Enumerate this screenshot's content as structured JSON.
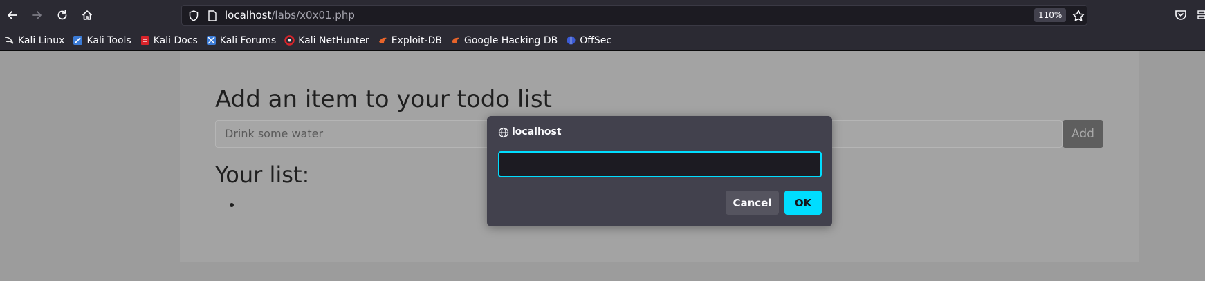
{
  "browser": {
    "url_host": "localhost",
    "url_path": "/labs/x0x01.php",
    "zoom": "110%",
    "icons": {
      "back": "back-arrow-icon",
      "forward": "forward-arrow-icon",
      "reload": "reload-icon",
      "home": "home-icon",
      "shield": "tracking-shield-icon",
      "page": "page-icon",
      "bookmark": "star-icon",
      "pocket": "pocket-icon"
    }
  },
  "bookmarks": [
    {
      "label": "Kali Linux",
      "icon": "kali-dragon-icon",
      "color": "#2a2a2a"
    },
    {
      "label": "Kali Tools",
      "icon": "kali-tools-icon",
      "color": "#3b7bd6"
    },
    {
      "label": "Kali Docs",
      "icon": "kali-docs-icon",
      "color": "#d8232a"
    },
    {
      "label": "Kali Forums",
      "icon": "kali-forums-icon",
      "color": "#3b7bd6"
    },
    {
      "label": "Kali NetHunter",
      "icon": "nethunter-icon",
      "color": "#d8232a"
    },
    {
      "label": "Exploit-DB",
      "icon": "exploit-db-icon",
      "color": "#e8642a"
    },
    {
      "label": "Google Hacking DB",
      "icon": "ghdb-icon",
      "color": "#e8642a"
    },
    {
      "label": "OffSec",
      "icon": "offsec-icon",
      "color": "#3b5bd6"
    }
  ],
  "page": {
    "heading": "Add an item to your todo list",
    "input_placeholder": "Drink some water",
    "add_label": "Add",
    "list_heading": "Your list:"
  },
  "dialog": {
    "title": "localhost",
    "input_value": "",
    "cancel_label": "Cancel",
    "ok_label": "OK",
    "accent_color": "#00ddff"
  }
}
